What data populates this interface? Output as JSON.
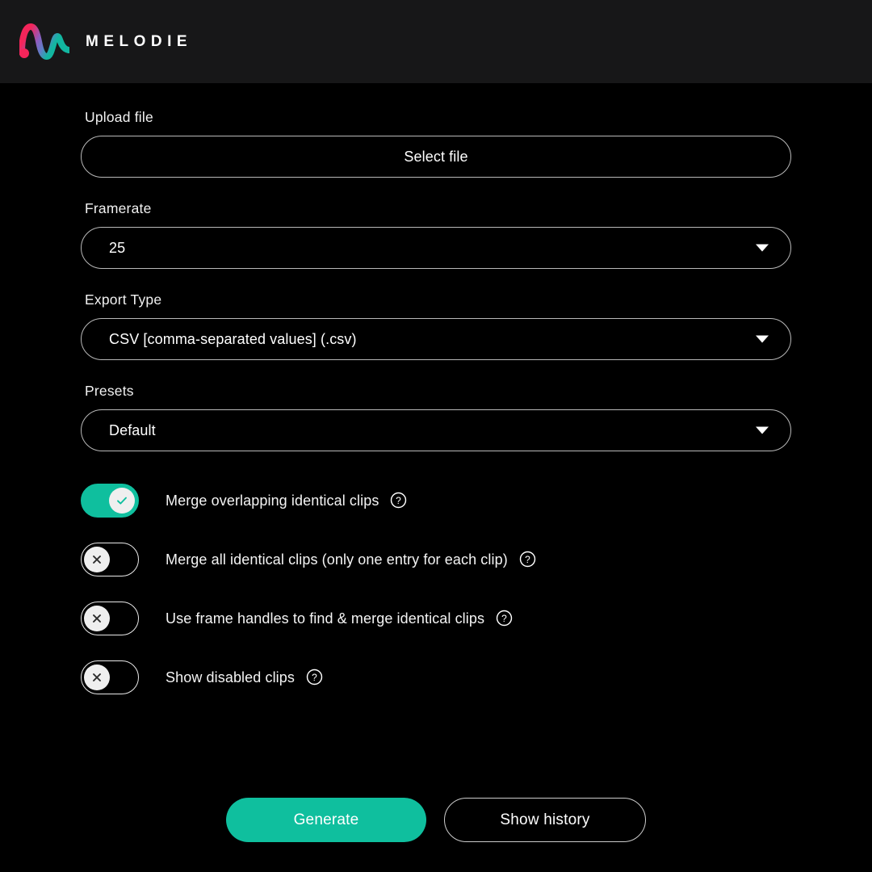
{
  "header": {
    "brand": "MELODIE",
    "logo_icon": "melodie-waveform-logo",
    "background_color": "#171718",
    "logo_gradient": [
      "#F4255A",
      "#7B66C8",
      "#12B6A0"
    ]
  },
  "theme": {
    "page_background": "#000000",
    "accent": "#0FBF9E",
    "border": "#b9b9b9",
    "text": "#ffffff"
  },
  "form": {
    "upload": {
      "label": "Upload file",
      "button_label": "Select file"
    },
    "framerate": {
      "label": "Framerate",
      "value": "25",
      "caret_icon": "chevron-down-icon"
    },
    "export_type": {
      "label": "Export Type",
      "value": "CSV [comma-separated values] (.csv)",
      "caret_icon": "chevron-down-icon"
    },
    "presets": {
      "label": "Presets",
      "value": "Default",
      "caret_icon": "chevron-down-icon"
    }
  },
  "toggles": [
    {
      "name": "merge-overlapping-identical-clips",
      "label": "Merge overlapping identical clips",
      "state": "on",
      "knob_icon": "check-icon",
      "help_icon": "question-mark-icon"
    },
    {
      "name": "merge-all-identical-clips",
      "label": "Merge all identical clips (only one entry for each clip)",
      "state": "off",
      "knob_icon": "close-x-icon",
      "help_icon": "question-mark-icon"
    },
    {
      "name": "use-frame-handles",
      "label": "Use frame handles to find & merge identical clips",
      "state": "off",
      "knob_icon": "close-x-icon",
      "help_icon": "question-mark-icon"
    },
    {
      "name": "show-disabled-clips",
      "label": "Show disabled clips",
      "state": "off",
      "knob_icon": "close-x-icon",
      "help_icon": "question-mark-icon"
    }
  ],
  "actions": {
    "generate_label": "Generate",
    "history_label": "Show history"
  }
}
